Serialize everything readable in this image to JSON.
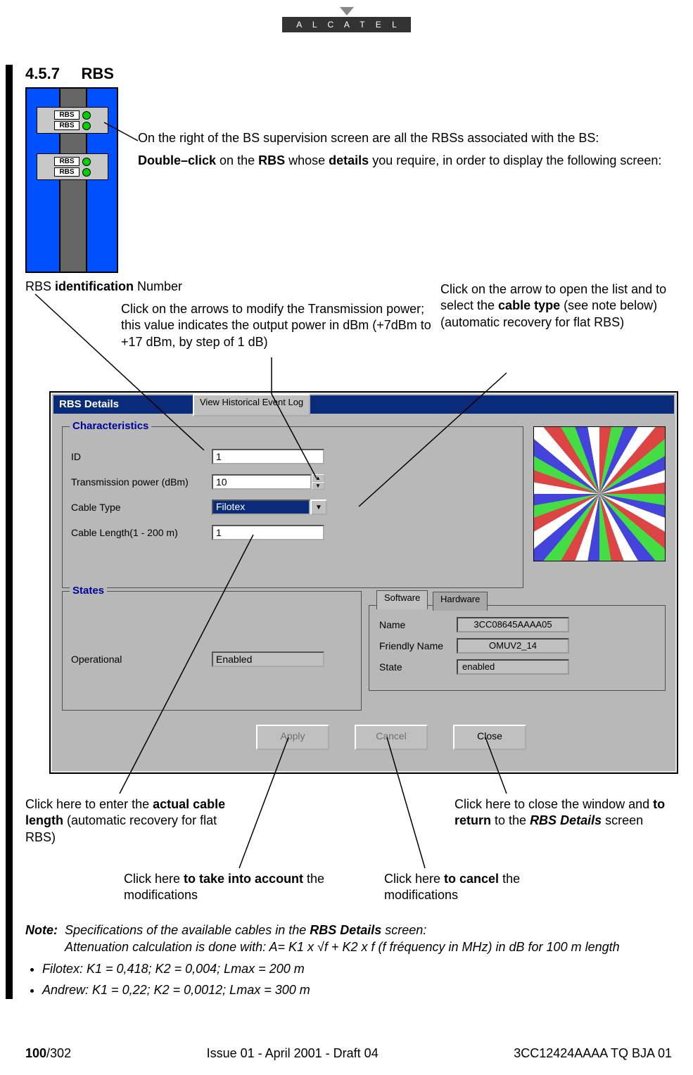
{
  "logo_text": "A L C A T E L",
  "heading": {
    "num": "4.5.7",
    "title": "RBS"
  },
  "rbs_label": "RBS",
  "intro": {
    "line1": "On the right of the BS supervision screen are all the RBSs associated with the BS:",
    "line2_pre": "Double–click",
    "line2_mid": " on the ",
    "line2_b1": "RBS",
    "line2_mid2": " whose ",
    "line2_b2": "details",
    "line2_post": " you require, in order to display the following screen:"
  },
  "callouts": {
    "id": {
      "pre": "RBS ",
      "b": "identification",
      "post": " Number"
    },
    "tx": "Click on the arrows to modify the Transmission power; this value indicates the output power in dBm (+7dBm to +17 dBm, by step of 1 dB)",
    "cable_type": {
      "pre": "Click on the arrow to open the list and to select the ",
      "b": "cable type",
      "post": " (see note below)(automatic recovery for flat RBS)"
    },
    "cable_len": {
      "pre": "Click here to enter the ",
      "b": "actual cable length",
      "post": " (automatic recovery for flat RBS)"
    },
    "apply": {
      "pre": "Click here ",
      "b": "to take into account",
      "post": " the modifications"
    },
    "cancel": {
      "pre": "Click here ",
      "b": "to cancel",
      "post": " the modifications"
    },
    "close": {
      "pre": "Click here to close the window and ",
      "b": "to return",
      "post": " to the ",
      "bi": "RBS Details",
      "post2": " screen"
    }
  },
  "dialog": {
    "title": "RBS Details",
    "history_btn": "View Historical Event Log",
    "group_char": "Characteristics",
    "group_states": "States",
    "labels": {
      "id": "ID",
      "tx": "Transmission power (dBm)",
      "cable_type": "Cable Type",
      "cable_len": "Cable Length(1 - 200 m)",
      "operational": "Operational"
    },
    "values": {
      "id": "1",
      "tx": "10",
      "cable_type": "Filotex",
      "cable_len": "1",
      "operational": "Enabled"
    },
    "tabs": {
      "software": "Software",
      "hardware": "Hardware"
    },
    "panel": {
      "name_lbl": "Name",
      "name_val": "3CC08645AAAA05",
      "friendly_lbl": "Friendly Name",
      "friendly_val": "OMUV2_14",
      "state_lbl": "State",
      "state_val": "enabled"
    },
    "buttons": {
      "apply": "Apply",
      "cancel": "Cancel",
      "close": "Close"
    }
  },
  "note": {
    "label": "Note:",
    "line1_pre": "Specifications of the available cables in the ",
    "line1_b": "RBS Details",
    "line1_post": " screen:",
    "line2": "Attenuation calculation is done with: A= K1 x √f + K2 x f (f fréquency in MHz) in dB for 100 m length",
    "bul1": "Filotex: K1 = 0,418; K2 = 0,004; Lmax = 200 m",
    "bul2": "Andrew: K1 = 0,22; K2 = 0,0012; Lmax = 300 m"
  },
  "footer": {
    "left_b": "100",
    "left": "/302",
    "center": "Issue 01 - April 2001 - Draft 04",
    "right": "3CC12424AAAA TQ BJA 01"
  }
}
